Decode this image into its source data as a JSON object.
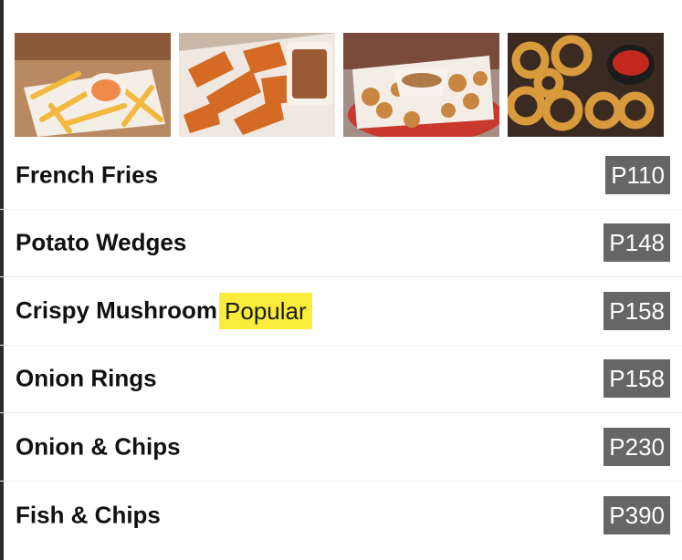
{
  "photos": [
    {
      "alt": "french-fries-photo"
    },
    {
      "alt": "potato-wedges-photo"
    },
    {
      "alt": "crispy-mushroom-photo"
    },
    {
      "alt": "onion-rings-photo"
    }
  ],
  "menu": {
    "items": [
      {
        "name": "French Fries",
        "badge": "",
        "price": "P110"
      },
      {
        "name": "Potato Wedges",
        "badge": "",
        "price": "P148"
      },
      {
        "name": "Crispy Mushroom",
        "badge": "Popular",
        "price": "P158"
      },
      {
        "name": "Onion Rings",
        "badge": "",
        "price": "P158"
      },
      {
        "name": "Onion & Chips",
        "badge": "",
        "price": "P230"
      },
      {
        "name": "Fish & Chips",
        "badge": "",
        "price": "P390"
      }
    ]
  },
  "colors": {
    "badge_bg": "#f9ec3a",
    "price_bg": "#666666",
    "price_text": "#ffffff",
    "divider": "#ececec"
  }
}
